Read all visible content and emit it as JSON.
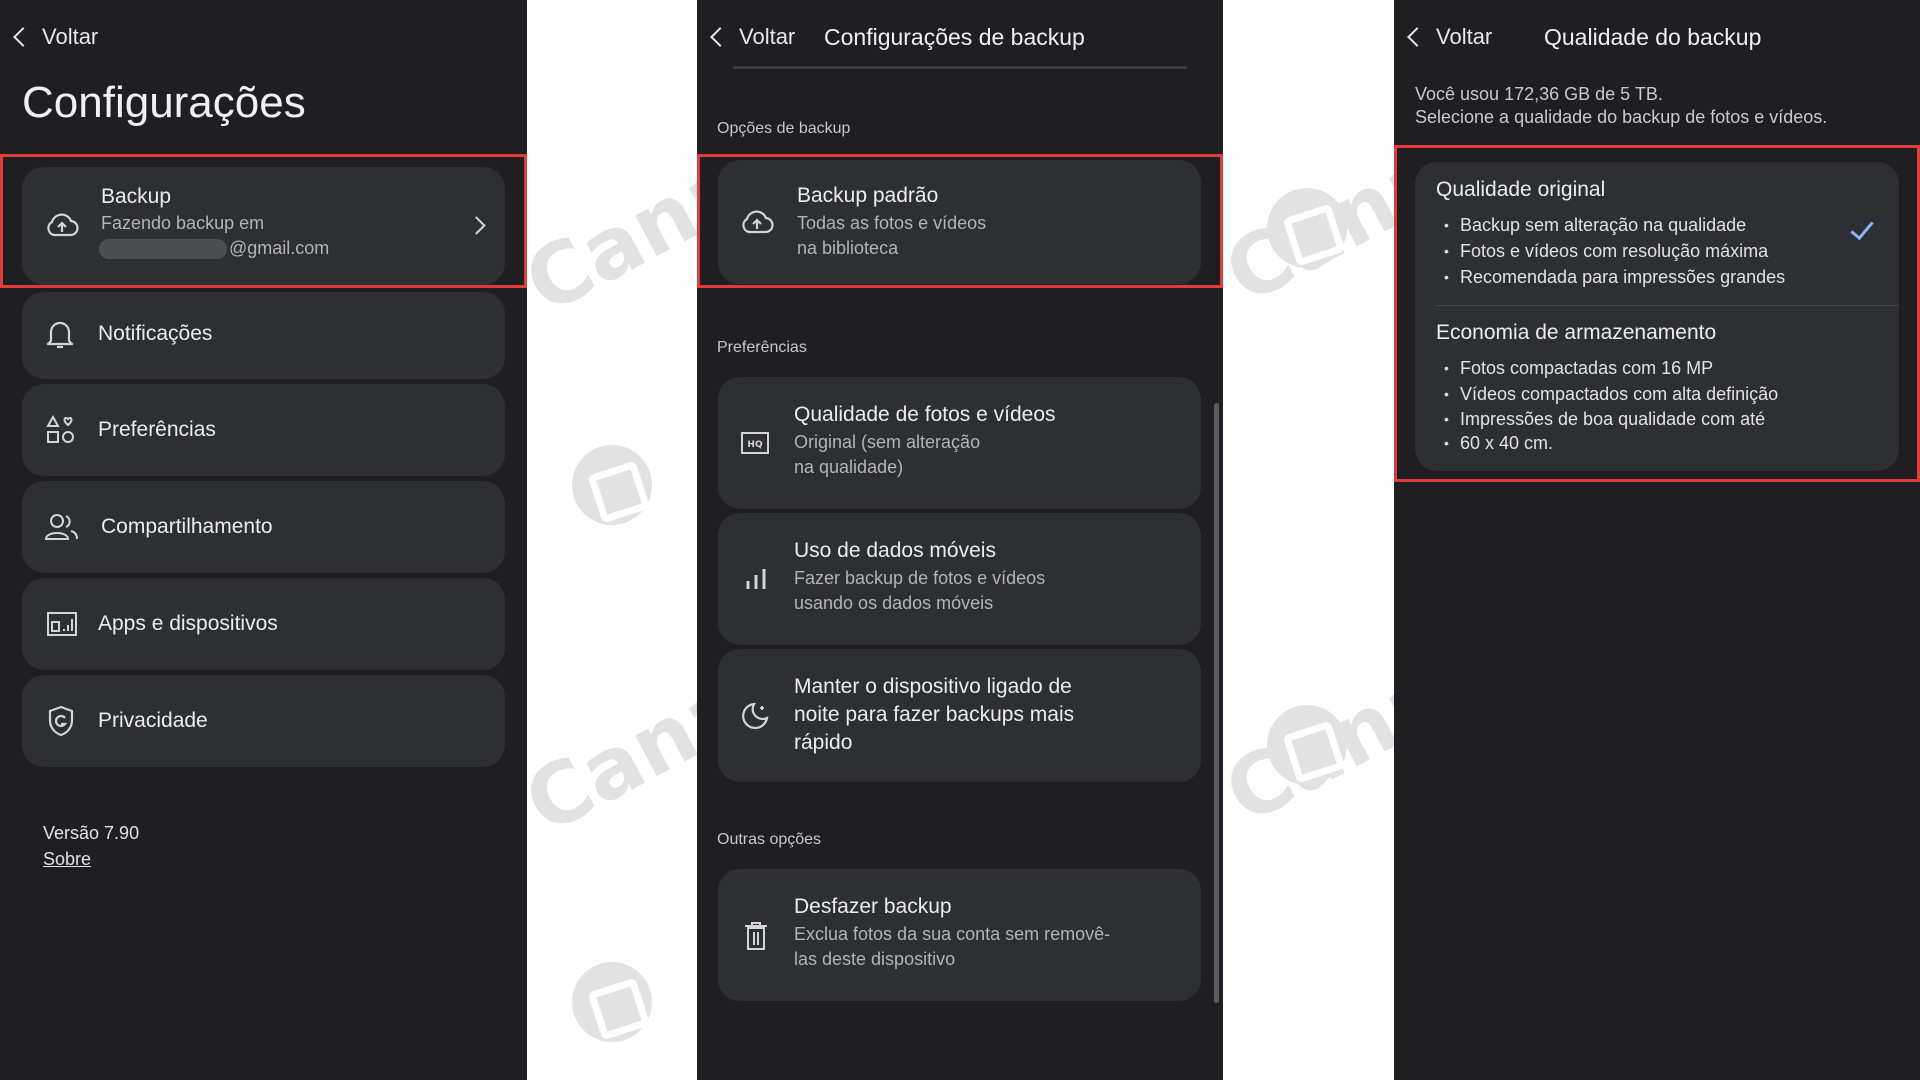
{
  "panel1": {
    "back_label": "Voltar",
    "title": "Configurações",
    "items": [
      {
        "label": "Backup",
        "sub1": "Fazendo backup em",
        "sub2": "@gmail.com",
        "icon": "cloud-upload-icon"
      },
      {
        "label": "Notificações",
        "icon": "bell-icon"
      },
      {
        "label": "Preferências",
        "icon": "preferences-icon"
      },
      {
        "label": "Compartilhamento",
        "icon": "people-icon"
      },
      {
        "label": "Apps e dispositivos",
        "icon": "devices-icon"
      },
      {
        "label": "Privacidade",
        "icon": "shield-icon"
      }
    ],
    "version": "Versão 7.90",
    "about_link": "Sobre"
  },
  "panel2": {
    "back_label": "Voltar",
    "title": "Configurações de backup",
    "section_backup": "Opções de backup",
    "backup_default": {
      "title": "Backup padrão",
      "sub1": "Todas as fotos e vídeos",
      "sub2": "na biblioteca",
      "icon": "cloud-upload-icon"
    },
    "section_prefs": "Preferências",
    "prefs": [
      {
        "title": "Qualidade de fotos e vídeos",
        "sub1": "Original (sem alteração",
        "sub2": "na qualidade)",
        "icon": "hq-icon"
      },
      {
        "title": "Uso de dados móveis",
        "sub1": "Fazer backup de fotos e vídeos",
        "sub2": "usando os dados móveis",
        "icon": "signal-bars-icon"
      },
      {
        "title1": "Manter o dispositivo ligado de",
        "title2": "noite para fazer backups mais",
        "title3": "rápido",
        "icon": "moon-icon"
      }
    ],
    "section_other": "Outras opções",
    "undo": {
      "title": "Desfazer backup",
      "sub1": "Exclua fotos da sua conta sem removê-",
      "sub2": "las deste dispositivo",
      "icon": "trash-icon"
    }
  },
  "panel3": {
    "back_label": "Voltar",
    "title": "Qualidade do backup",
    "info1": "Você usou 172,36 GB de 5 TB.",
    "info2": "Selecione a qualidade do backup de fotos e vídeos.",
    "options": [
      {
        "title": "Qualidade original",
        "selected": true,
        "bullets": [
          "Backup sem alteração na qualidade",
          "Fotos e vídeos com resolução máxima",
          "Recomendada para impressões grandes"
        ]
      },
      {
        "title": "Economia de armazenamento",
        "selected": false,
        "bullets": [
          "Fotos compactadas com 16 MP",
          "Vídeos compactados com alta definição",
          "Impressões de boa qualidade com até",
          "60 x 40 cm."
        ]
      }
    ]
  },
  "watermark": {
    "text_1": "Canaltech",
    "text_2": "Canaltech",
    "text_3": "Canaltech",
    "text_4": "Canaltech"
  },
  "colors": {
    "panel_bg": "#1f1f21",
    "card_bg": "#2e2f33",
    "highlight": "#e33a3a",
    "check": "#8ab4f8"
  }
}
